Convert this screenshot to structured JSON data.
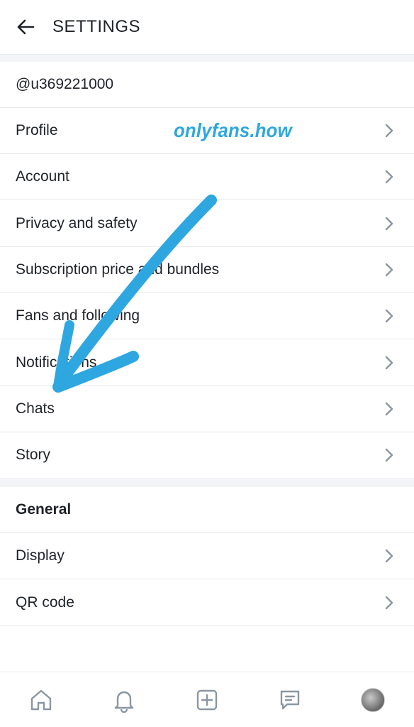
{
  "header": {
    "title": "SETTINGS",
    "back_icon": "arrow-left-icon"
  },
  "username": "@u369221000",
  "watermark": "onlyfans.how",
  "menu_items": [
    {
      "label": "Profile"
    },
    {
      "label": "Account"
    },
    {
      "label": "Privacy and safety"
    },
    {
      "label": "Subscription price and bundles"
    },
    {
      "label": "Fans and following"
    },
    {
      "label": "Notifications"
    },
    {
      "label": "Chats"
    },
    {
      "label": "Story"
    }
  ],
  "general": {
    "heading": "General",
    "items": [
      {
        "label": "Display"
      },
      {
        "label": "QR code"
      }
    ]
  },
  "bottom_nav": {
    "icons": [
      "home-icon",
      "bell-icon",
      "add-post-icon",
      "messages-icon",
      "avatar"
    ]
  },
  "colors": {
    "accent_arrow": "#2ea7e0",
    "text": "#1f2329",
    "chevron": "#8a96a3",
    "divider": "#e6e9ee",
    "section_gap": "#f2f4f7"
  }
}
